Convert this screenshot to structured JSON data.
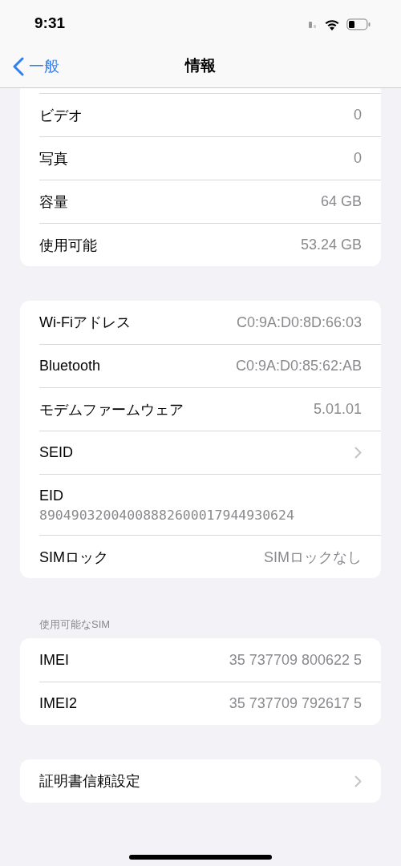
{
  "status_bar": {
    "time": "9:31"
  },
  "nav_bar": {
    "back": "一般",
    "title": "情報"
  },
  "groups": [
    {
      "cut_top": true,
      "rows": [
        {
          "kind": "value",
          "label": "ビデオ",
          "value": "0"
        },
        {
          "kind": "value",
          "label": "写真",
          "value": "0"
        },
        {
          "kind": "value",
          "label": "容量",
          "value": "64 GB"
        },
        {
          "kind": "value",
          "label": "使用可能",
          "value": "53.24 GB"
        }
      ]
    },
    {
      "cut_top": false,
      "rows": [
        {
          "kind": "value",
          "label": "Wi-Fiアドレス",
          "value": "C0:9A:D0:8D:66:03"
        },
        {
          "kind": "value",
          "label": "Bluetooth",
          "value": "C0:9A:D0:85:62:AB"
        },
        {
          "kind": "value",
          "label": "モデムファームウェア",
          "value": "5.01.01"
        },
        {
          "kind": "chevron",
          "label": "SEID"
        },
        {
          "kind": "stacked",
          "label": "EID",
          "value": "89049032004008882600017944930624"
        },
        {
          "kind": "value",
          "label": "SIMロック",
          "value": "SIMロックなし"
        }
      ]
    },
    {
      "cut_top": false,
      "header": "使用可能なSIM",
      "rows": [
        {
          "kind": "value",
          "label": "IMEI",
          "value": "35 737709 800622 5"
        },
        {
          "kind": "value",
          "label": "IMEI2",
          "value": "35 737709 792617 5"
        }
      ]
    },
    {
      "cut_top": false,
      "rows": [
        {
          "kind": "chevron",
          "label": "証明書信頼設定"
        }
      ]
    }
  ]
}
